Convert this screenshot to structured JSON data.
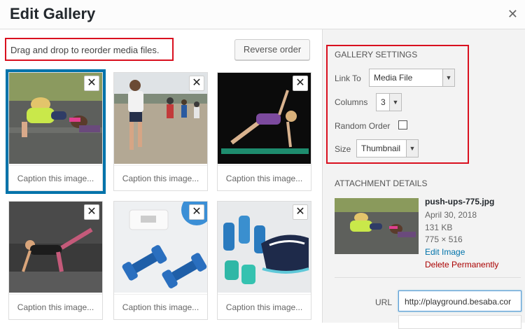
{
  "window": {
    "title": "Edit Gallery"
  },
  "toolbar": {
    "instructions": "Drag and drop to reorder media files.",
    "reverse_label": "Reverse order"
  },
  "gallery": {
    "caption_placeholder": "Caption this image...",
    "remove_glyph": "✕",
    "items": [
      {
        "alt": "push-ups",
        "selected": true
      },
      {
        "alt": "runners"
      },
      {
        "alt": "side plank"
      },
      {
        "alt": "leg raise"
      },
      {
        "alt": "blue dumbbells"
      },
      {
        "alt": "dumbbells and sneakers"
      }
    ]
  },
  "sidebar": {
    "gallery_settings_title": "GALLERY SETTINGS",
    "link_to_label": "Link To",
    "link_to_value": "Media File",
    "columns_label": "Columns",
    "columns_value": "3",
    "random_order_label": "Random Order",
    "size_label": "Size",
    "size_value": "Thumbnail",
    "attachment_title": "ATTACHMENT DETAILS",
    "attachment": {
      "filename": "push-ups-775.jpg",
      "date": "April 30, 2018",
      "filesize": "131 KB",
      "dimensions": "775 × 516",
      "edit_link": "Edit Image",
      "delete_link": "Delete Permanently"
    },
    "url_label": "URL",
    "url_value": "http://playground.besaba.cor"
  },
  "colors": {
    "accent_blue": "#0073aa",
    "highlight_red": "#d9101f",
    "delete_red": "#a00"
  }
}
